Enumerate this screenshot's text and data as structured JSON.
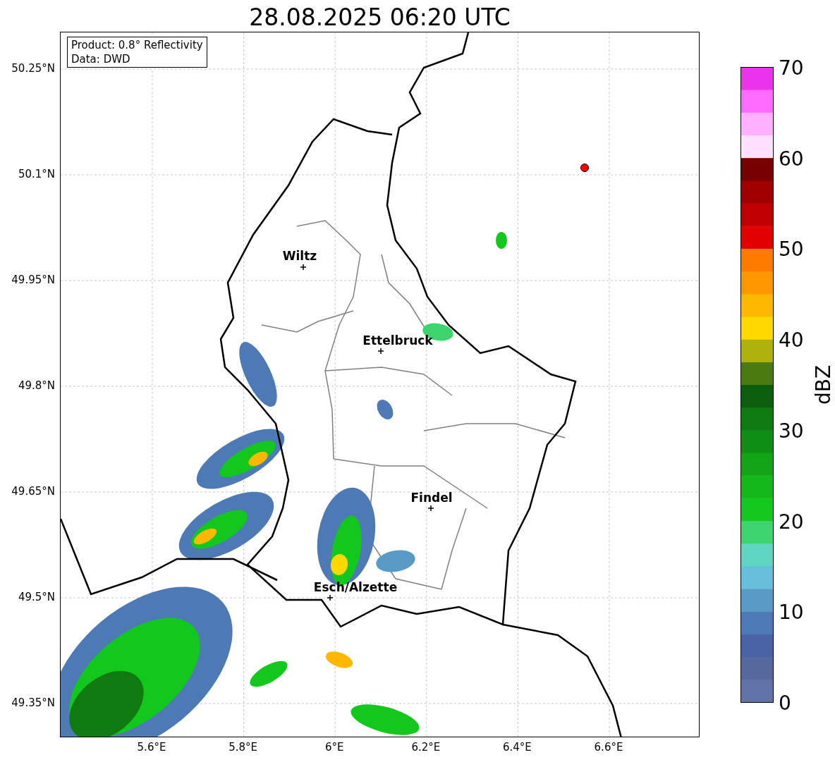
{
  "title": "28.08.2025 06:20 UTC",
  "info_box": [
    "Product: 0.8° Reflectivity",
    "Data: DWD"
  ],
  "y_ticks": [
    "50.25°N",
    "50.1°N",
    "49.95°N",
    "49.8°N",
    "49.65°N",
    "49.5°N",
    "49.35°N"
  ],
  "x_ticks": [
    "5.6°E",
    "5.8°E",
    "6°E",
    "6.2°E",
    "6.4°E",
    "6.6°E"
  ],
  "cities": [
    {
      "name": "Wiltz"
    },
    {
      "name": "Ettelbruck"
    },
    {
      "name": "Findel"
    },
    {
      "name": "Esch/Alzette"
    }
  ],
  "colorbar": {
    "ticks": [
      "70",
      "60",
      "50",
      "40",
      "30",
      "20",
      "10",
      "0"
    ],
    "label": "dBZ"
  }
}
